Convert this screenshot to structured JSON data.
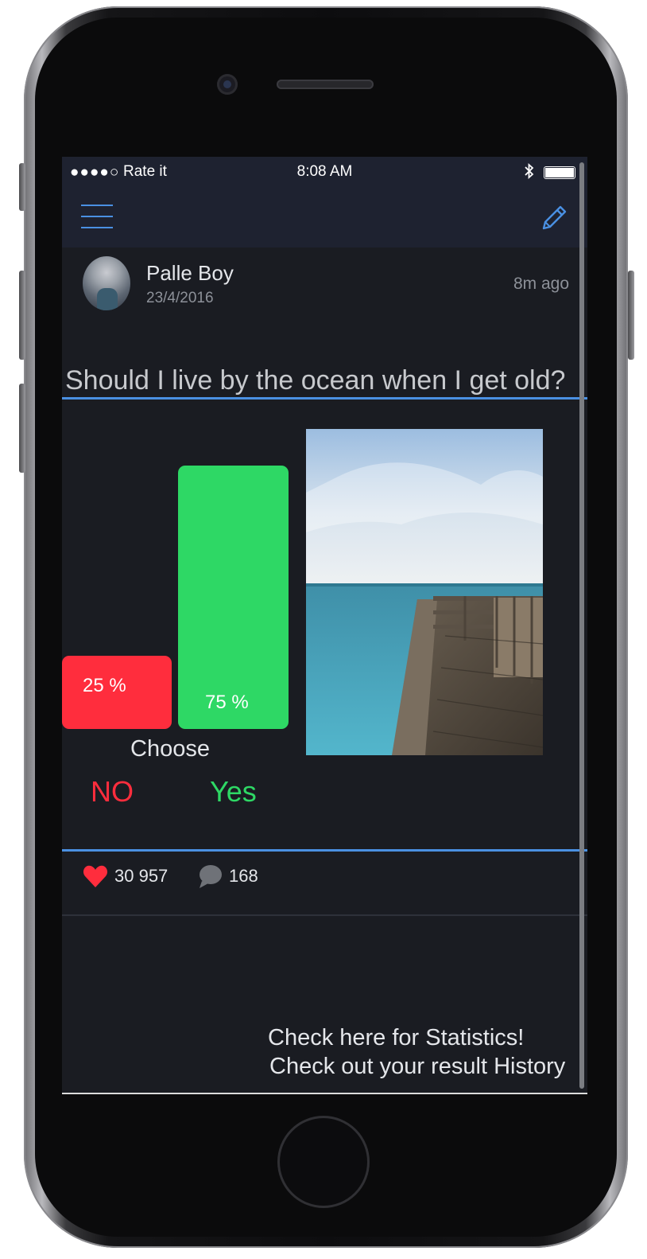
{
  "status_bar": {
    "signal": "●●●●○",
    "carrier": "Rate it",
    "time": "8:08 AM",
    "bluetooth": "✱"
  },
  "nav": {
    "menu_icon": "hamburger-icon",
    "edit_icon": "pencil-icon",
    "accent": "#4a90e2"
  },
  "post": {
    "author": "Palle Boy",
    "date": "23/4/2016",
    "time_ago": "8m ago",
    "question": "Should I live by the ocean when I get old?"
  },
  "poll": {
    "no_percent_label": "25 %",
    "yes_percent_label": "75 %",
    "no_share": 0.25,
    "yes_share": 0.75,
    "choose_label": "Choose",
    "no_option": "NO",
    "yes_option": "Yes",
    "no_color": "#ff2d3d",
    "yes_color": "#2ed865"
  },
  "stats": {
    "likes": "30 957",
    "comments": "168"
  },
  "links": {
    "statistics": "Check here for Statistics!",
    "history": "Check out your result History"
  }
}
